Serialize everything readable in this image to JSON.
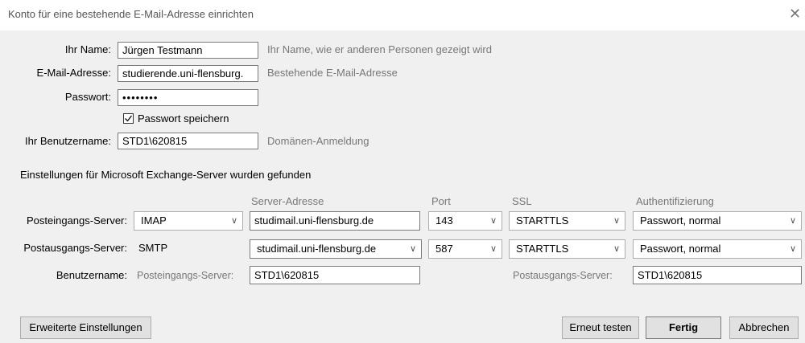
{
  "window": {
    "title": "Konto für eine bestehende E-Mail-Adresse einrichten",
    "close_glyph": "✕"
  },
  "account": {
    "name_label": "Ihr Name:",
    "name_value": "Jürgen Testmann",
    "name_hint": "Ihr Name, wie er anderen Personen gezeigt wird",
    "email_label": "E-Mail-Adresse:",
    "email_value": "studierende.uni-flensburg.",
    "email_hint": "Bestehende E-Mail-Adresse",
    "password_label": "Passwort:",
    "password_value": "••••••••",
    "save_password_label": "Passwort speichern",
    "save_password_checked": true,
    "username_label": "Ihr Benutzername:",
    "username_value": "STD1\\620815",
    "username_hint": "Domänen-Anmeldung"
  },
  "found_message": "Einstellungen für Microsoft Exchange-Server wurden gefunden",
  "columns": {
    "server": "Server-Adresse",
    "port": "Port",
    "ssl": "SSL",
    "auth": "Authentifizierung"
  },
  "incoming": {
    "label": "Posteingangs-Server:",
    "protocol": "IMAP",
    "server": "studimail.uni-flensburg.de",
    "port": "143",
    "ssl": "STARTTLS",
    "auth": "Passwort, normal"
  },
  "outgoing": {
    "label": "Postausgangs-Server:",
    "protocol": "SMTP",
    "server": "studimail.uni-flensburg.de",
    "port": "587",
    "ssl": "STARTTLS",
    "auth": "Passwort, normal"
  },
  "server_usernames": {
    "label": "Benutzername:",
    "incoming_label": "Posteingangs-Server:",
    "incoming_value": "STD1\\620815",
    "outgoing_label": "Postausgangs-Server:",
    "outgoing_value": "STD1\\620815"
  },
  "buttons": {
    "advanced": "Erweiterte Einstellungen",
    "retest": "Erneut testen",
    "done": "Fertig",
    "cancel": "Abbrechen"
  },
  "icons": {
    "dropdown": "chevron-down-icon",
    "check": "checkmark-icon",
    "close": "close-icon"
  }
}
